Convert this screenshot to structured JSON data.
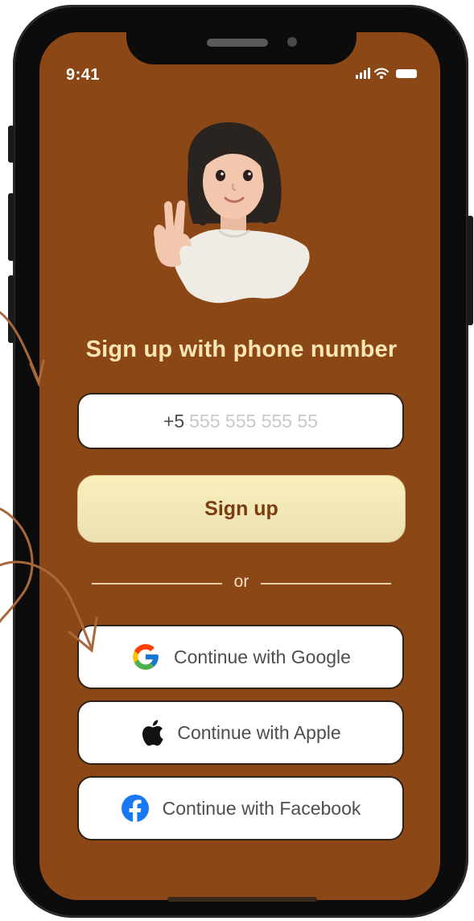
{
  "status_bar": {
    "time": "9:41"
  },
  "heading": "Sign up with phone number",
  "phone_input": {
    "prefix": "+5",
    "placeholder": "555 555 555 55"
  },
  "signup_button": "Sign up",
  "divider": "or",
  "social": {
    "google": "Continue with Google",
    "apple": "Continue with Apple",
    "facebook": "Continue with Facebook"
  },
  "colors": {
    "screen_bg": "#8c4716",
    "heading": "#fbe6b4",
    "button_bg": "#f4e8b6",
    "button_text": "#7a3d10",
    "annotation_arrow": "#a8683c"
  },
  "icons": [
    "google-icon",
    "apple-icon",
    "facebook-icon",
    "signal-icon",
    "wifi-icon",
    "battery-icon"
  ]
}
